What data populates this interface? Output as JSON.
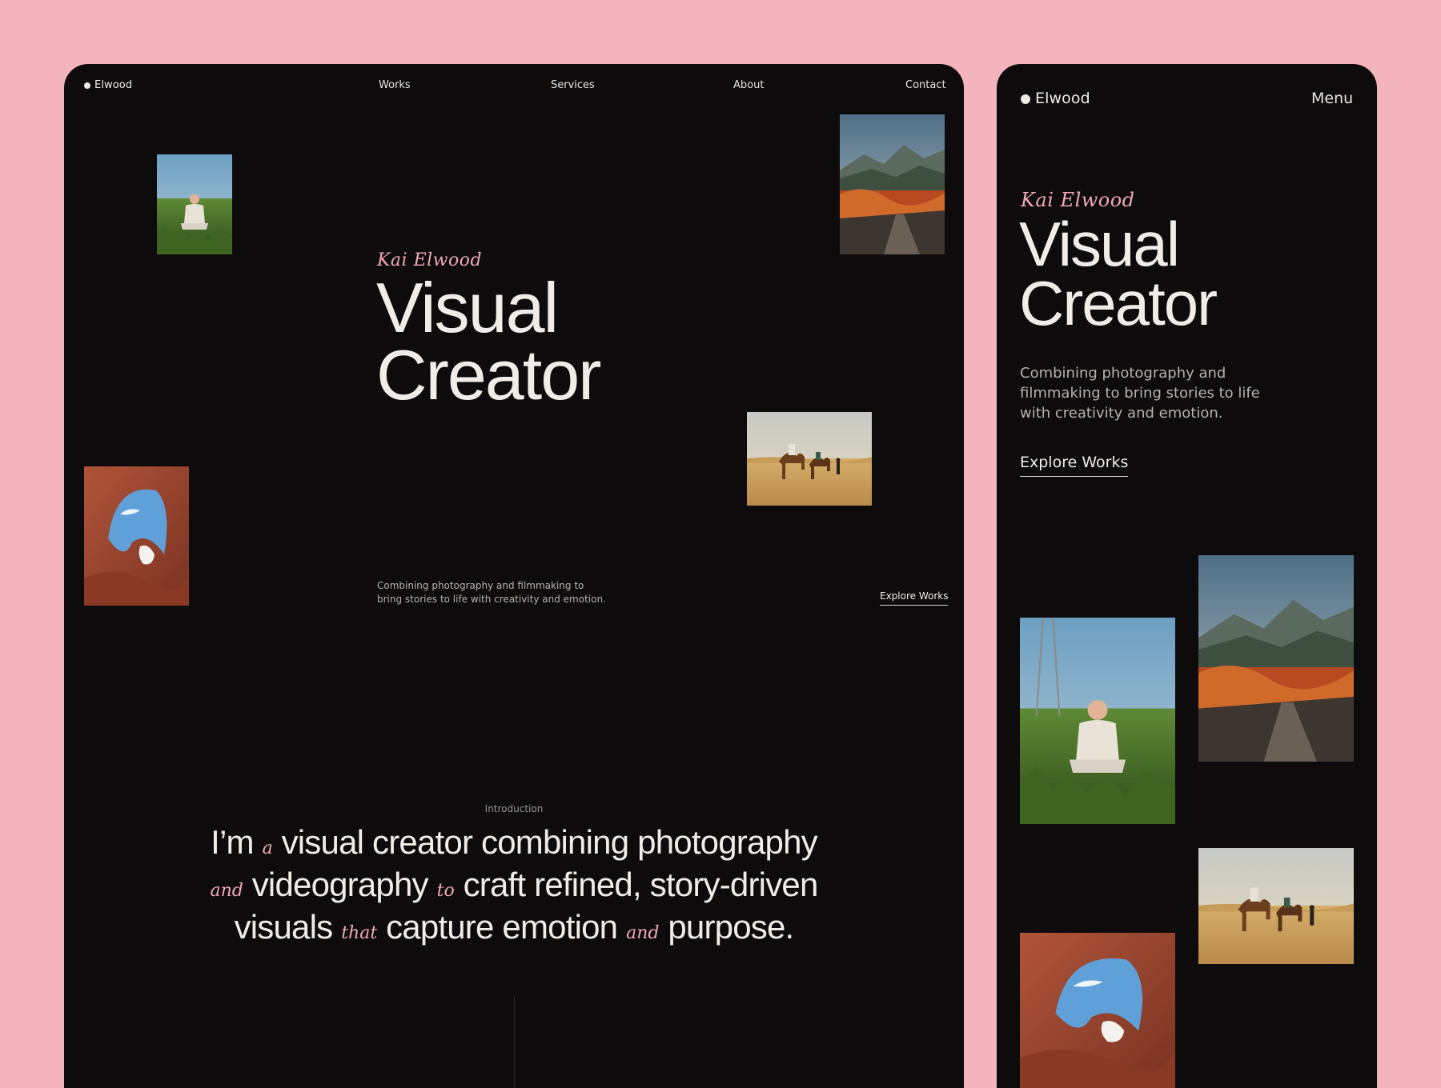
{
  "desktop": {
    "brand": "Elwood",
    "nav": {
      "works": "Works",
      "services": "Services",
      "about": "About",
      "contact": "Contact"
    },
    "hero": {
      "name": "Kai Elwood",
      "title_line1": "Visual",
      "title_line2": "Creator",
      "subtitle_line1": "Combining photography and filmmaking to",
      "subtitle_line2": "bring stories to life with creativity and emotion.",
      "cta": "Explore Works"
    },
    "photos": {
      "person": "person-in-field-photo",
      "mountains": "autumn-mountains-photo",
      "camels": "desert-camels-photo",
      "arch": "rock-arch-photo"
    },
    "intro": {
      "label": "Introduction",
      "parts": {
        "p1": "I’m",
        "p2": "a",
        "p3": "visual creator combining",
        "p4": "photography",
        "p5": "and",
        "p6": "videography",
        "p7": "to",
        "p8": "craft",
        "p9": "refined, story-driven visuals",
        "p10": "that",
        "p11": "capture emotion",
        "p12": "and",
        "p13": "purpose."
      }
    }
  },
  "mobile": {
    "brand": "Elwood",
    "menu": "Menu",
    "hero": {
      "name": "Kai Elwood",
      "title_line1": "Visual",
      "title_line2": "Creator",
      "subtitle_line1": "Combining photography and",
      "subtitle_line2": "filmmaking to bring stories to life",
      "subtitle_line3": "with creativity and emotion.",
      "cta": "Explore Works"
    }
  },
  "colors": {
    "background": "#f4b4bd",
    "panel": "#0e0b0c",
    "accent": "#f0a9b5",
    "text": "#f1ece8",
    "muted": "#b8b1ad"
  }
}
